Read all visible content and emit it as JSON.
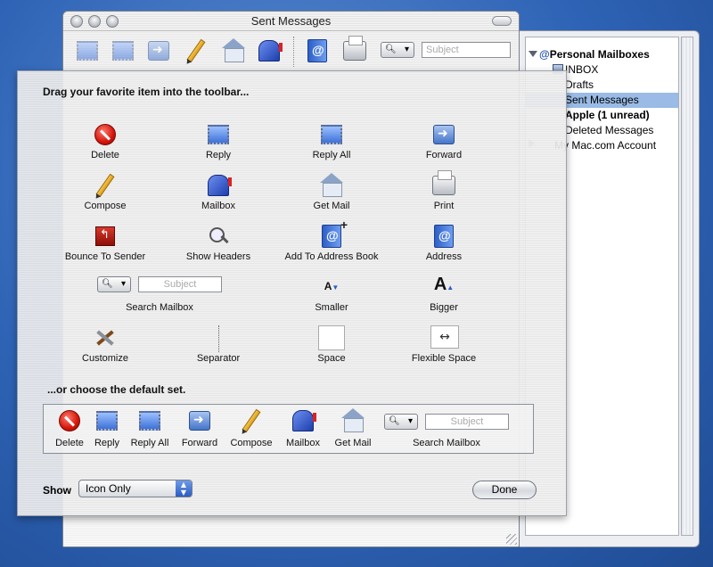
{
  "window": {
    "title": "Sent Messages"
  },
  "window_toolbar": {
    "search_placeholder": "Subject"
  },
  "mailboxes": {
    "root_label": "Personal Mailboxes",
    "items": [
      {
        "label": "INBOX"
      },
      {
        "label": "Drafts"
      },
      {
        "label": "Sent Messages",
        "selected": true
      },
      {
        "label": "Apple (1 unread)",
        "bold": true
      },
      {
        "label": "Deleted Messages"
      },
      {
        "label": "My Mac.com Account"
      }
    ]
  },
  "sheet": {
    "heading": "Drag your favorite item into the toolbar...",
    "items": [
      {
        "label": "Delete",
        "icon": "delete-icon"
      },
      {
        "label": "Reply",
        "icon": "reply-icon"
      },
      {
        "label": "Reply All",
        "icon": "reply-all-icon"
      },
      {
        "label": "Forward",
        "icon": "forward-icon"
      },
      {
        "label": "Compose",
        "icon": "pencil-icon"
      },
      {
        "label": "Mailbox",
        "icon": "mailbox-icon"
      },
      {
        "label": "Get Mail",
        "icon": "house-icon"
      },
      {
        "label": "Print",
        "icon": "printer-icon"
      },
      {
        "label": "Bounce To Sender",
        "icon": "bounce-icon"
      },
      {
        "label": "Show Headers",
        "icon": "magnifier-icon"
      },
      {
        "label": "Add To Address Book",
        "icon": "address-book-add-icon"
      },
      {
        "label": "Address",
        "icon": "address-book-icon"
      },
      {
        "label": "Search Mailbox",
        "icon": "search-field"
      },
      {
        "label": "Smaller",
        "icon": "smaller-text-icon"
      },
      {
        "label": "Bigger",
        "icon": "bigger-text-icon"
      },
      {
        "label": "Customize",
        "icon": "tools-icon"
      },
      {
        "label": "Separator",
        "icon": "separator-icon"
      },
      {
        "label": "Space",
        "icon": "space-icon"
      },
      {
        "label": "Flexible Space",
        "icon": "flexible-space-icon"
      }
    ],
    "search_placeholder": "Subject",
    "default_heading": "...or choose the default set.",
    "default_set": [
      {
        "label": "Delete"
      },
      {
        "label": "Reply"
      },
      {
        "label": "Reply All"
      },
      {
        "label": "Forward"
      },
      {
        "label": "Compose"
      },
      {
        "label": "Mailbox"
      },
      {
        "label": "Get Mail"
      },
      {
        "label": "Search Mailbox"
      }
    ],
    "show_label": "Show",
    "show_value": "Icon Only",
    "done_label": "Done"
  },
  "colors": {
    "desktop": "#2e63b5",
    "selection": "#99bbe6"
  }
}
